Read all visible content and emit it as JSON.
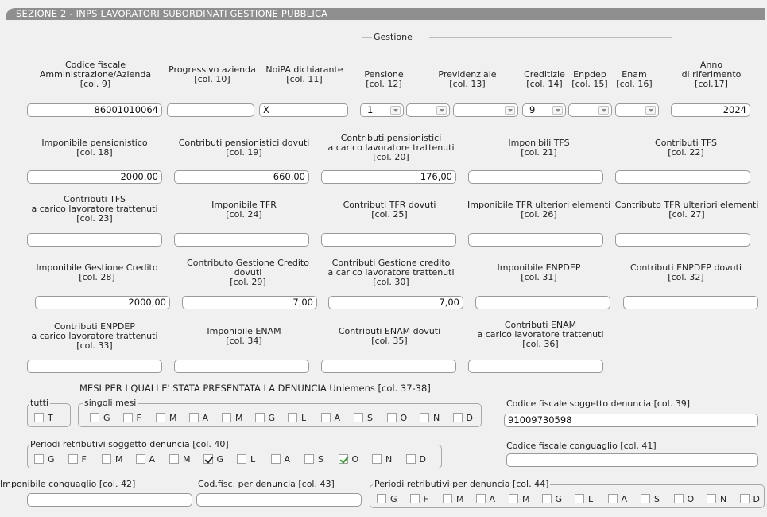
{
  "section_title": "SEZIONE 2 - INPS LAVORATORI SUBORDINATI GESTIONE PUBBLICA",
  "gestione_label": "Gestione",
  "row1": {
    "cf_amm": {
      "l1": "Codice fiscale",
      "l2": "Amministrazione/Azienda",
      "l3": "[col. 9]",
      "value": "86001010064"
    },
    "progressivo": {
      "l1": "Progressivo azienda",
      "l2": "[col. 10]",
      "value": ""
    },
    "noipa": {
      "l1": "NoiPA dichiarante",
      "l2": "[col. 11]",
      "value": "X"
    },
    "pensione": {
      "l1": "Pensione",
      "l2": "[col. 12]",
      "value": "1"
    },
    "previdenziale": {
      "l1": "Previdenziale",
      "l2": "[col. 13]",
      "value": ""
    },
    "previdenziale2": {
      "value": ""
    },
    "creditizie": {
      "l1": "Creditizie",
      "l2": "[col. 14]",
      "value": "9"
    },
    "enpdep": {
      "l1": "Enpdep",
      "l2": "[col. 15]",
      "value": ""
    },
    "enam": {
      "l1": "Enam",
      "l2": "[col. 16]",
      "value": ""
    },
    "anno": {
      "l1": "Anno",
      "l2": "di riferimento",
      "l3": "[col.17]",
      "value": "2024"
    }
  },
  "row2": {
    "c18": {
      "l1": "Imponibile pensionistico",
      "l2": "[col. 18]",
      "value": "2000,00"
    },
    "c19": {
      "l1": "Contributi pensionistici dovuti",
      "l2": "[col. 19]",
      "value": "660,00"
    },
    "c20": {
      "l1": "Contributi pensionistici",
      "l2": "a carico lavoratore trattenuti",
      "l3": "[col. 20]",
      "value": "176,00"
    },
    "c21": {
      "l1": "Imponibili TFS",
      "l2": "[col. 21]",
      "value": ""
    },
    "c22": {
      "l1": "Contributi TFS",
      "l2": "[col. 22]",
      "value": ""
    }
  },
  "row3": {
    "c23": {
      "l1": "Contributi TFS",
      "l2": "a carico lavoratore trattenuti",
      "l3": "[col. 23]",
      "value": ""
    },
    "c24": {
      "l1": "Imponibile TFR",
      "l2": "[col. 24]",
      "value": ""
    },
    "c25": {
      "l1": "Contributi TFR dovuti",
      "l2": "[col. 25]",
      "value": ""
    },
    "c26": {
      "l1": "Imponibile TFR ulteriori elementi",
      "l2": "[col. 26]",
      "value": ""
    },
    "c27": {
      "l1": "Contributo TFR ulteriori elementi",
      "l2": "[col. 27]",
      "value": ""
    }
  },
  "row4": {
    "c28": {
      "l1": "Imponibile Gestione Credito",
      "l2": "[col. 28]",
      "value": "2000,00"
    },
    "c29": {
      "l1": "Contributo Gestione Credito",
      "l2": "dovuti",
      "l3": "[col. 29]",
      "value": "7,00"
    },
    "c30": {
      "l1": "Contributi Gestione credito",
      "l2": "a carico lavoratore trattenuti",
      "l3": "[col. 30]",
      "value": "7,00"
    },
    "c31": {
      "l1": "Imponibile ENPDEP",
      "l2": "[col. 31]",
      "value": ""
    },
    "c32": {
      "l1": "Contributi ENPDEP dovuti",
      "l2": "[col. 32]",
      "value": ""
    }
  },
  "row5": {
    "c33": {
      "l1": "Contributi ENPDEP",
      "l2": "a carico lavoratore trattenuti",
      "l3": "[col. 33]",
      "value": ""
    },
    "c34": {
      "l1": "Imponibile ENAM",
      "l2": "[col. 34]",
      "value": ""
    },
    "c35": {
      "l1": "Contributi ENAM dovuti",
      "l2": "[col. 35]",
      "value": ""
    },
    "c36": {
      "l1": "Contributi ENAM",
      "l2": "a carico lavoratore trattenuti",
      "l3": "[col. 36]",
      "value": ""
    }
  },
  "mesi": {
    "heading": "MESI PER I QUALI E' STATA PRESENTATA LA DENUNCIA Uniemens [col. 37-38]",
    "tutti_label": "tutti",
    "tutti_box": "T",
    "singoli_label": "singoli mesi",
    "months": [
      "G",
      "F",
      "M",
      "A",
      "M",
      "G",
      "L",
      "A",
      "S",
      "O",
      "N",
      "D"
    ]
  },
  "cf_denuncia": {
    "label": "Codice fiscale soggetto denuncia [col. 39]",
    "value": "91009730598"
  },
  "periodi40": {
    "label": "Periodi retributivi soggetto denuncia [col. 40]",
    "months": [
      "G",
      "F",
      "M",
      "A",
      "M",
      "G",
      "L",
      "A",
      "S",
      "O",
      "N",
      "D"
    ],
    "checked_indices": [
      5,
      9
    ]
  },
  "cf_conguaglio": {
    "label": "Codice fiscale conguaglio [col. 41]",
    "value": ""
  },
  "imp_conguaglio": {
    "label": "Imponibile conguaglio [col. 42]",
    "value": ""
  },
  "codfisc_denuncia": {
    "label": "Cod.fisc. per denuncia [col. 43]",
    "value": ""
  },
  "periodi44": {
    "label": "Periodi retributivi per denuncia [col. 44]",
    "months": [
      "G",
      "F",
      "M",
      "A",
      "M",
      "G",
      "L",
      "A",
      "S",
      "O",
      "N",
      "D"
    ]
  }
}
